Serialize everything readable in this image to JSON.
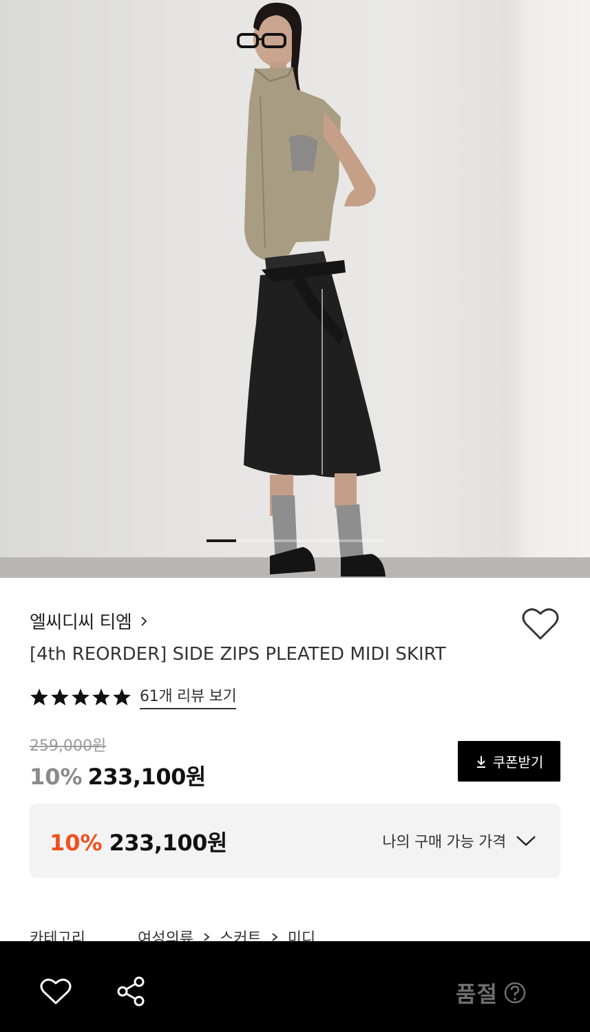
{
  "hero": {
    "image_description_icon": "product-photo",
    "slides_total": 6,
    "slide_active": 1
  },
  "product": {
    "brand": "엘씨디씨 티엠",
    "title": "[4th REORDER] SIDE ZIPS PLEATED MIDI SKIRT",
    "rating_stars": 5,
    "review_link": "61개 리뷰 보기",
    "original_price": "259,000원",
    "discount_rate": "10%",
    "sale_price": "233,100원",
    "coupon_button": "쿠폰받기"
  },
  "my_price": {
    "discount_rate": "10%",
    "price": "233,100원",
    "label": "나의 구매 가능 가격"
  },
  "category": {
    "label": "카테고리",
    "crumbs": [
      "여성의류",
      "스커트",
      "미디"
    ]
  },
  "bottom_bar": {
    "status": "품절"
  },
  "colors": {
    "accent_discount": "#f0501e",
    "button_bg": "#000000",
    "bottom_bar_bg": "#000000"
  }
}
